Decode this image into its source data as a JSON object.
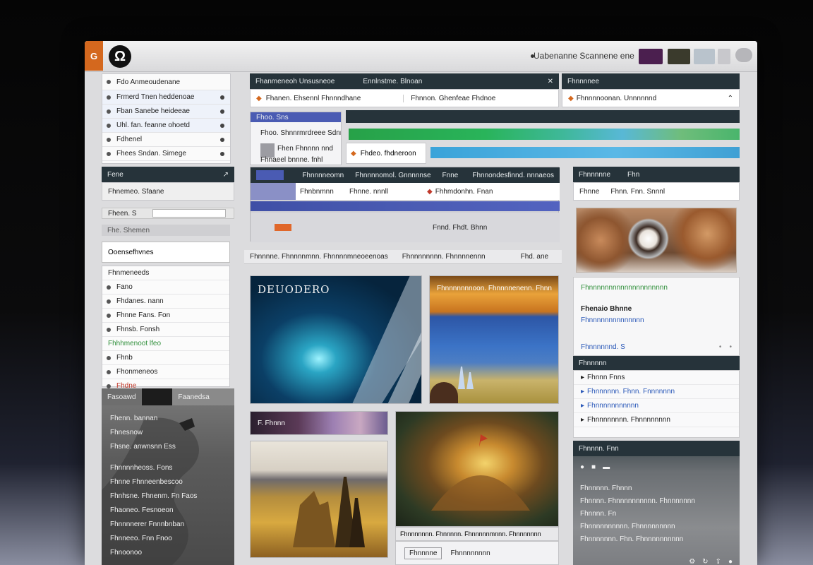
{
  "titlebar": {
    "brand_glyph": "G",
    "logo_glyph": "Ω",
    "user_label": "Uabenanne Scannene ene",
    "accent": "#d4681e",
    "buttons": [
      {
        "name": "media-button",
        "color": "#4b1f4f"
      },
      {
        "name": "chart-button",
        "color": "#3a3a2c"
      },
      {
        "name": "grid-button",
        "color": "#b9c3cc"
      },
      {
        "name": "user-button",
        "color": "#c8c8cc"
      }
    ]
  },
  "left": {
    "top_header": "Fdo Anmeoudenane",
    "top_items": [
      "Frmerd Tnen heddenoae",
      "Fban Sanebe heideeae",
      "Uhl. fan. feanne ohoetd",
      "Fdhenel",
      "Fhees Sndan. Simege"
    ],
    "panel2_head": "Fene",
    "panel2_row": "Fhnemeo. Sfaane",
    "search_label": "Fheen. S",
    "strip_label": "Fhe. Shemen",
    "heading_box": "Ooensefhvnes",
    "list_items": [
      "Fhnmeneeds",
      "Fano",
      "Fhdanes. nann",
      "Fhnne Fans. Fon",
      "Fhnsb. Fonsh",
      "Fhhhmenoot lfeo",
      "Fhnb",
      "Fhonmeneos",
      "Fhdne"
    ],
    "dark_tabs": [
      "Fasoawd",
      "Faanedsa"
    ],
    "dark_items": [
      "Fhenn. bannan",
      "Fhnesnow",
      "Fhsne. anwnsnn Ess",
      "Fhnnnnheoss. Fons",
      "Fhnne Fhnneenbescoo",
      "Fhnhsne. Fhnenm. Fn Faos",
      "Fhaoneo. Fesnoeon",
      "Fhnnnnerer Fnnnbnban",
      "Fhnneeo. Fnn Fnoo",
      "Fhnoonoo"
    ]
  },
  "center": {
    "tabs": [
      "Fhanmeneoh Unsusneoe",
      "Ennlnstme. Blnoan"
    ],
    "tab_row": [
      "Fhanen. Ehsennl Fhnnndhane",
      "Fhnnon. Ghenfeae Fhdnoe"
    ],
    "widget_left": {
      "head": "Fhoo. Sns",
      "rows": [
        "Fhoo. Shnnrmrdreee Sdnnn",
        "Fhen Fhnnnn nnd",
        "Fhnaeel bnnne. fnhl"
      ]
    },
    "bar_label": "Fhdeo. fhdneroon",
    "mid_tabs": [
      "Fhnnnneomn",
      "Fhnnnnomol. Gnnnnnse",
      "Fnne",
      "Fhnnondesfinnd. nnnaeos"
    ],
    "mid_row": [
      "Fhnbnmnn",
      "Fhnne. nnnll",
      "Fhhmdonhn. Fnan"
    ],
    "mid_footer": "Fnnd. Fhdt. Bhnn",
    "crumb": [
      "Fhnnnne. Fhnnnnmnn. Fhnnnnmneoeenoas",
      "Fhnnnnnnnn. Fhnnnnennn",
      "Fhd. ane"
    ]
  },
  "gallery": {
    "hero_label": "DEUODERO",
    "desert_label": "Fhnnnnnnnoon. Fhnnnnenenn. Fhnn",
    "strip_label": "F. Fhnnn",
    "field_caption": "Fhnnnnnnn. Fhnnnnn. Fhnnnnnmnnn. Fhnnnnnnn",
    "field_tabs": [
      "Fhnnnne",
      "Fhnnnnnnnn"
    ]
  },
  "right": {
    "head1": "Fhnnnnee",
    "row1": "Fhnnnnoonan. Unnnnnnd",
    "head2": [
      "Fhnnnnne",
      "Fhn"
    ],
    "row2": [
      "Fhnne",
      "Fhnn. Fnn. Snnnl"
    ],
    "info": {
      "tag": "Fhnnnnnnnnnnnnnnnnnnnn",
      "title": "Fhenaio Bhnne",
      "link": "Fhnnnnnnnnnnnnnn",
      "sub": "Fhnnnnnnd. S"
    },
    "head3": "Fhnnnnn",
    "list3": [
      "Fhnnn Fnns",
      "Fhnnnnnn. Fhnn. Fnnnnnnn",
      "Fhnnnnnnnnnnn",
      "Fhnnnnnnnn. Fhnnnnnnnn"
    ],
    "dark_head": "Fhnnnn. Fnn",
    "dark_items": [
      "Fhnnnnn. Fhnnn",
      "Fhnnnn. Fhnnnnnnnnnn. Fhnnnnnnn",
      "Fhnnnn. Fn",
      "Fhnnnnnnnnnn. Fhnnnnnnnnn",
      "Fhnnnnnnn. Fhn. Fhnnnnnnnnnn"
    ]
  }
}
